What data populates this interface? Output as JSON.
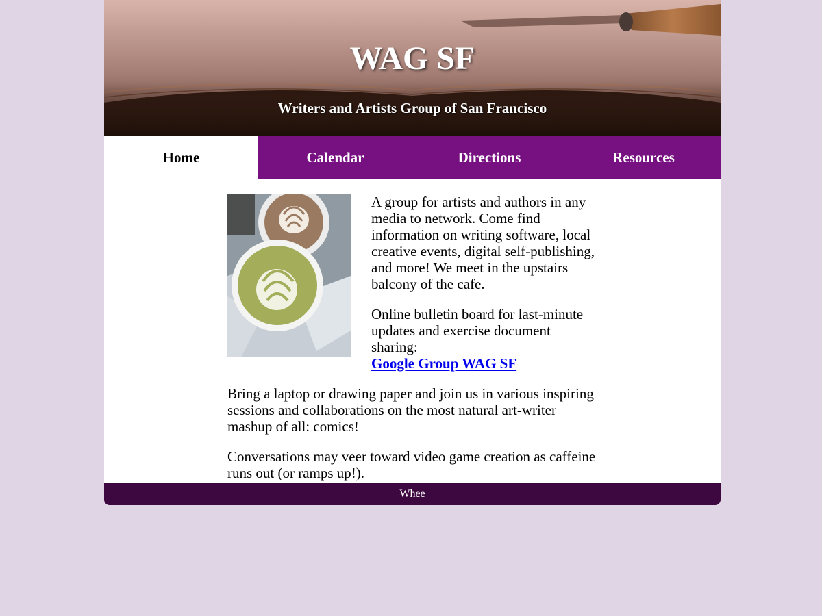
{
  "header": {
    "title": "WAG SF",
    "subtitle": "Writers and Artists Group of San Francisco"
  },
  "nav": {
    "items": [
      {
        "label": "Home",
        "active": true
      },
      {
        "label": "Calendar",
        "active": false
      },
      {
        "label": "Directions",
        "active": false
      },
      {
        "label": "Resources",
        "active": false
      }
    ]
  },
  "main": {
    "intro": "A group for artists and authors in any media to network. Come find information on writing software, local creative events, digital self-publishing, and more! We meet in the upstairs balcony of the cafe.",
    "bulletin_text": "Online bulletin board for last-minute updates and exercise document sharing:",
    "bulletin_link": "Google Group WAG SF",
    "session_text": "Bring a laptop or drawing paper and join us in various inspiring sessions and collaborations on the most natural art-writer mashup of all: comics!",
    "closing_text": "Conversations may veer toward video game creation as caffeine runs out (or ramps up!)."
  },
  "footer": {
    "text": "Whee"
  },
  "colors": {
    "page_bg": "#dfd5e5",
    "nav_bg": "#771080",
    "footer_bg": "#3d0840",
    "link": "#0000ee"
  }
}
